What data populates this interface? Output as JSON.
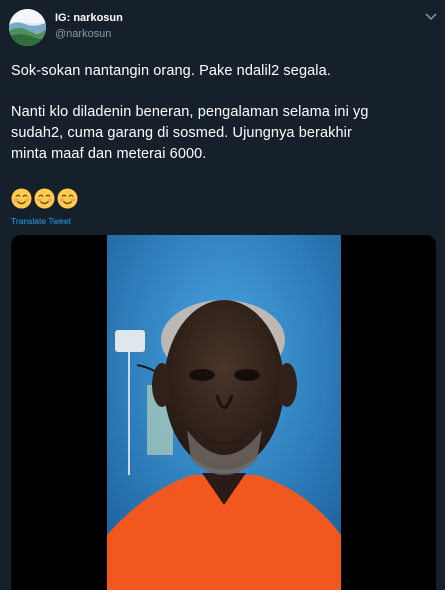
{
  "tweet": {
    "display_name": "IG: narkosun",
    "handle": "@narkosun",
    "text_lines": [
      "Sok-sokan nantangin orang. Pake ndalil2 segala.",
      "Nanti klo diladenin beneran, pengalaman selama ini yg",
      "sudah2, cuma garang di sosmed. Ujungnya berakhir",
      "minta maaf dan meterai 6000."
    ],
    "emoji_count_label": "😊😊😊",
    "translate_label": "Translate Tweet"
  },
  "icons": {
    "avatar": "avatar-image",
    "caret": "chevron-down-icon",
    "emoji": "smiling-face-icon",
    "media": "video-still"
  },
  "colors": {
    "background": "#15202b",
    "text": "#ffffff",
    "secondary": "#8899a6",
    "link": "#1da1f2",
    "shirt": "#f0581f",
    "wall": "#2a86c7"
  }
}
